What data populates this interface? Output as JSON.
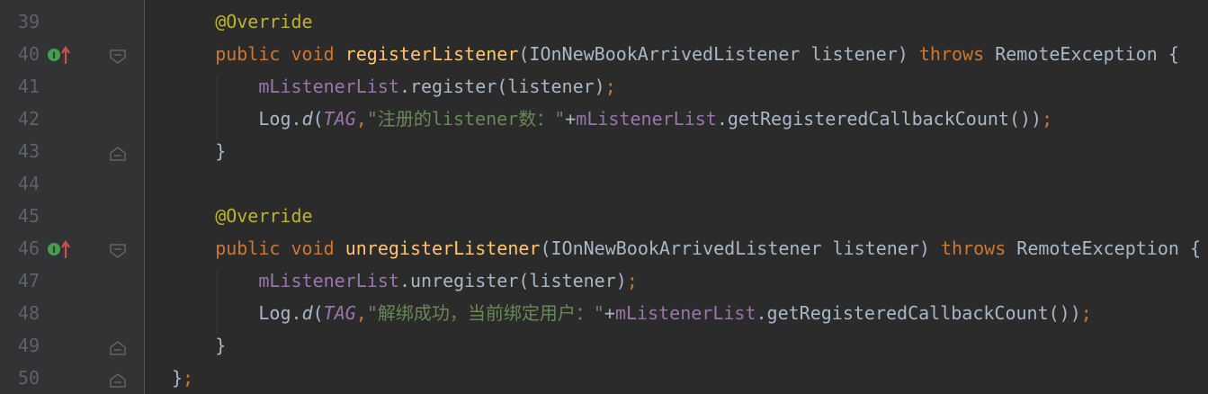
{
  "editor": {
    "lines": [
      {
        "num": "39",
        "indent": "    ",
        "marker": false,
        "fold": "none",
        "tokens": [
          {
            "t": "@Override",
            "c": "ann"
          }
        ]
      },
      {
        "num": "40",
        "indent": "    ",
        "marker": true,
        "fold": "open",
        "tokens": [
          {
            "t": "public ",
            "c": "kw"
          },
          {
            "t": "void ",
            "c": "kw"
          },
          {
            "t": "registerListener",
            "c": "fn"
          },
          {
            "t": "(IOnNewBookArrivedListener listener) ",
            "c": ""
          },
          {
            "t": "throws ",
            "c": "kw"
          },
          {
            "t": "RemoteException {",
            "c": ""
          }
        ]
      },
      {
        "num": "41",
        "indent": "        ",
        "marker": false,
        "fold": "none",
        "tokens": [
          {
            "t": "mListenerList",
            "c": "field"
          },
          {
            "t": ".register(listener)",
            "c": ""
          },
          {
            "t": ";",
            "c": "kw"
          }
        ]
      },
      {
        "num": "42",
        "indent": "        ",
        "marker": false,
        "fold": "none",
        "tokens": [
          {
            "t": "Log.",
            "c": ""
          },
          {
            "t": "d",
            "c": "italicm"
          },
          {
            "t": "(",
            "c": ""
          },
          {
            "t": "TAG",
            "c": "const"
          },
          {
            "t": ",",
            "c": "kw"
          },
          {
            "t": "\"注册的listener数：\"",
            "c": "str"
          },
          {
            "t": "+",
            "c": ""
          },
          {
            "t": "mListenerList",
            "c": "field"
          },
          {
            "t": ".getRegisteredCallbackCount())",
            "c": ""
          },
          {
            "t": ";",
            "c": "kw"
          }
        ]
      },
      {
        "num": "43",
        "indent": "    ",
        "marker": false,
        "fold": "close",
        "tokens": [
          {
            "t": "}",
            "c": ""
          }
        ]
      },
      {
        "num": "44",
        "indent": "",
        "marker": false,
        "fold": "none",
        "tokens": []
      },
      {
        "num": "45",
        "indent": "    ",
        "marker": false,
        "fold": "none",
        "tokens": [
          {
            "t": "@Override",
            "c": "ann"
          }
        ]
      },
      {
        "num": "46",
        "indent": "    ",
        "marker": true,
        "fold": "open",
        "tokens": [
          {
            "t": "public ",
            "c": "kw"
          },
          {
            "t": "void ",
            "c": "kw"
          },
          {
            "t": "unregisterListener",
            "c": "fn"
          },
          {
            "t": "(IOnNewBookArrivedListener listener) ",
            "c": ""
          },
          {
            "t": "throws ",
            "c": "kw"
          },
          {
            "t": "RemoteException {",
            "c": ""
          }
        ]
      },
      {
        "num": "47",
        "indent": "        ",
        "marker": false,
        "fold": "none",
        "tokens": [
          {
            "t": "mListenerList",
            "c": "field"
          },
          {
            "t": ".unregister(listener)",
            "c": ""
          },
          {
            "t": ";",
            "c": "kw"
          }
        ]
      },
      {
        "num": "48",
        "indent": "        ",
        "marker": false,
        "fold": "none",
        "tokens": [
          {
            "t": "Log.",
            "c": ""
          },
          {
            "t": "d",
            "c": "italicm"
          },
          {
            "t": "(",
            "c": ""
          },
          {
            "t": "TAG",
            "c": "const"
          },
          {
            "t": ",",
            "c": "kw"
          },
          {
            "t": "\"解绑成功，当前绑定用户：\"",
            "c": "str"
          },
          {
            "t": "+",
            "c": ""
          },
          {
            "t": "mListenerList",
            "c": "field"
          },
          {
            "t": ".getRegisteredCallbackCount())",
            "c": ""
          },
          {
            "t": ";",
            "c": "kw"
          }
        ]
      },
      {
        "num": "49",
        "indent": "    ",
        "marker": false,
        "fold": "close",
        "tokens": [
          {
            "t": "}",
            "c": ""
          }
        ]
      },
      {
        "num": "50",
        "indent": "",
        "marker": false,
        "fold": "close",
        "tokens": [
          {
            "t": "}",
            "c": ""
          },
          {
            "t": ";",
            "c": "kw"
          }
        ]
      }
    ],
    "marker_icon": "implementing-method-icon",
    "colors": {
      "background": "#2B2B2B",
      "gutter": "#313335",
      "line_number": "#606366",
      "keyword": "#CC7832",
      "annotation": "#BBB529",
      "method": "#FFC66D",
      "field": "#9876AA",
      "string": "#6A8759",
      "text": "#A9B7C6",
      "marker_green": "#499C54",
      "marker_red": "#C75450"
    }
  }
}
